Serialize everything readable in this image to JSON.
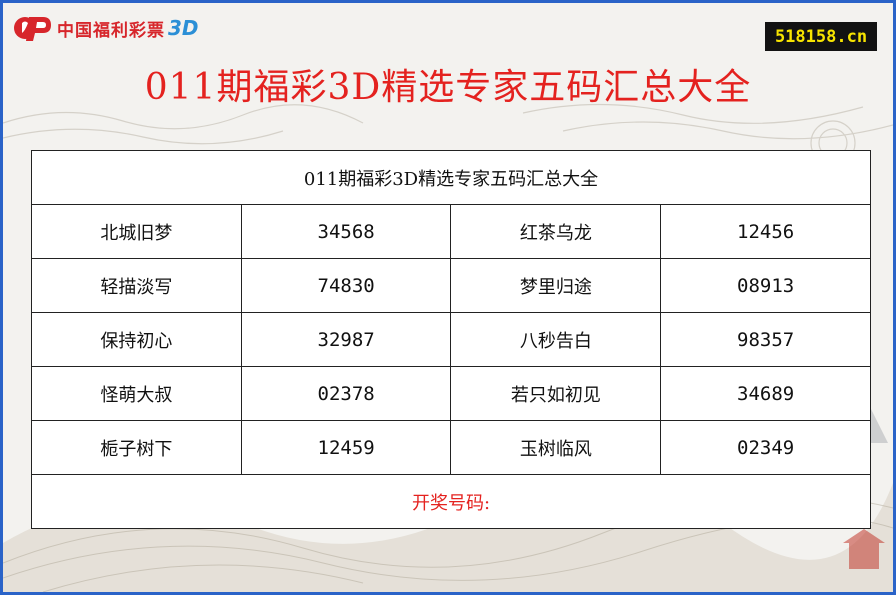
{
  "logo": {
    "name": "中国福利彩票",
    "suffix": "3D",
    "icon": "lottery-logo-icon"
  },
  "site_badge": "518158.cn",
  "page_title": "011期福彩3D精选专家五码汇总大全",
  "table": {
    "header": "011期福彩3D精选专家五码汇总大全",
    "rows": [
      {
        "left_name": "北城旧梦",
        "left_code": "34568",
        "right_name": "红茶乌龙",
        "right_code": "12456"
      },
      {
        "left_name": "轻描淡写",
        "left_code": "74830",
        "right_name": "梦里归途",
        "right_code": "08913"
      },
      {
        "left_name": "保持初心",
        "left_code": "32987",
        "right_name": "八秒告白",
        "right_code": "98357"
      },
      {
        "left_name": "怪萌大叔",
        "left_code": "02378",
        "right_name": "若只如初见",
        "right_code": "34689"
      },
      {
        "left_name": "栀子树下",
        "left_code": "12459",
        "right_name": "玉树临风",
        "right_code": "02349"
      }
    ],
    "footer": "开奖号码:"
  },
  "colors": {
    "border": "#2a63c8",
    "title": "#e4221f",
    "badge_bg": "#121212",
    "badge_fg": "#f7e400"
  }
}
